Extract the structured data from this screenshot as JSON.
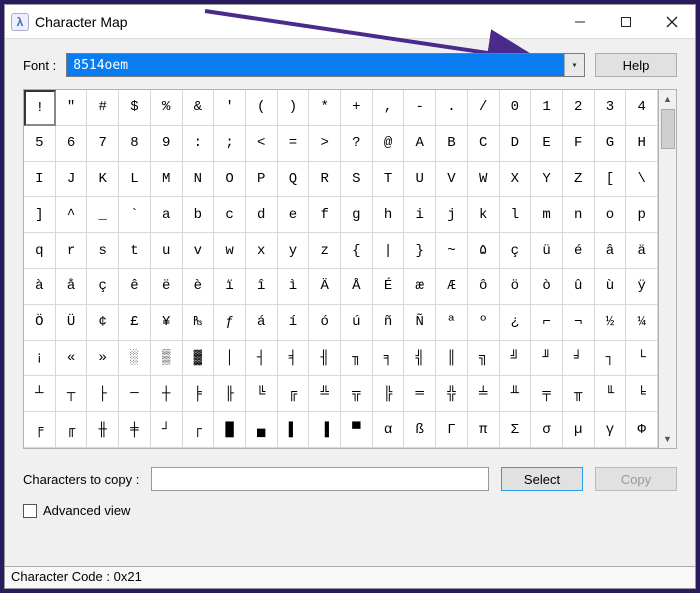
{
  "titlebar": {
    "app_icon": "λ",
    "title": "Character Map"
  },
  "font_row": {
    "label": "Font :",
    "selected": "8514oem",
    "help_label": "Help"
  },
  "grid": {
    "selected_index": 0,
    "chars": [
      "!",
      "\"",
      "#",
      "$",
      "%",
      "&",
      "'",
      "(",
      ")",
      "*",
      "+",
      ",",
      "-",
      ".",
      "/",
      "0",
      "1",
      "2",
      "3",
      "4",
      "5",
      "6",
      "7",
      "8",
      "9",
      ":",
      ";",
      "<",
      "=",
      ">",
      "?",
      "@",
      "A",
      "B",
      "C",
      "D",
      "E",
      "F",
      "G",
      "H",
      "I",
      "J",
      "K",
      "L",
      "M",
      "N",
      "O",
      "P",
      "Q",
      "R",
      "S",
      "T",
      "U",
      "V",
      "W",
      "X",
      "Y",
      "Z",
      "[",
      "\\",
      "]",
      "^",
      "_",
      "`",
      "a",
      "b",
      "c",
      "d",
      "e",
      "f",
      "g",
      "h",
      "i",
      "j",
      "k",
      "l",
      "m",
      "n",
      "o",
      "p",
      "q",
      "r",
      "s",
      "t",
      "u",
      "v",
      "w",
      "x",
      "y",
      "z",
      "{",
      "|",
      "}",
      "~",
      "۵",
      "ç",
      "ü",
      "é",
      "â",
      "ä",
      "à",
      "å",
      "ç",
      "ê",
      "ë",
      "è",
      "ï",
      "î",
      "ì",
      "Ä",
      "Å",
      "É",
      "æ",
      "Æ",
      "ô",
      "ö",
      "ò",
      "û",
      "ù",
      "ÿ",
      "Ö",
      "Ü",
      "¢",
      "£",
      "¥",
      "₧",
      "ƒ",
      "á",
      "í",
      "ó",
      "ú",
      "ñ",
      "Ñ",
      "ª",
      "º",
      "¿",
      "⌐",
      "¬",
      "½",
      "¼",
      "¡",
      "«",
      "»",
      "░",
      "▒",
      "▓",
      "│",
      "┤",
      "╡",
      "╢",
      "╖",
      "╕",
      "╣",
      "║",
      "╗",
      "╝",
      "╜",
      "╛",
      "┐",
      "└",
      "┴",
      "┬",
      "├",
      "─",
      "┼",
      "╞",
      "╟",
      "╚",
      "╔",
      "╩",
      "╦",
      "╠",
      "═",
      "╬",
      "╧",
      "╨",
      "╤",
      "╥",
      "╙",
      "╘",
      "╒",
      "╓",
      "╫",
      "╪",
      "┘",
      "┌",
      "█",
      "▄",
      "▌",
      "▐",
      "▀",
      "α",
      "ß",
      "Γ",
      "π",
      "Σ",
      "σ",
      "µ",
      "γ",
      "Φ"
    ]
  },
  "copy_row": {
    "label": "Characters to copy :",
    "value": "",
    "select_label": "Select",
    "copy_label": "Copy"
  },
  "advanced": {
    "label": "Advanced view",
    "checked": false
  },
  "status": {
    "text": "Character Code : 0x21"
  },
  "arrow_color": "#4a2a8a"
}
